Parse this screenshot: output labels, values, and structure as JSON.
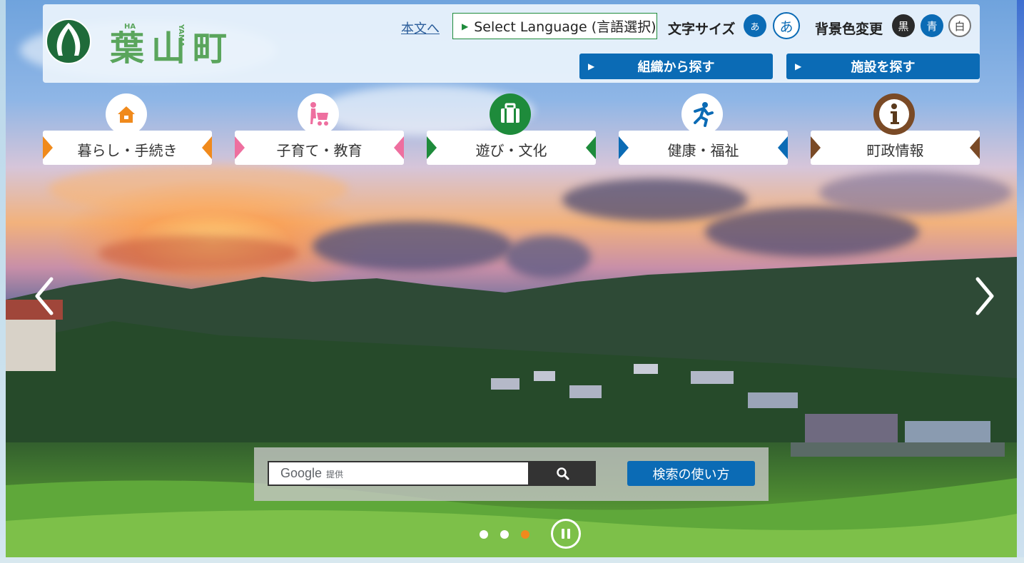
{
  "header": {
    "logo_text": "葉山町",
    "logo_romaji_ha": "HA",
    "logo_romaji_yama": "YAMA",
    "skip_link": "本文へ",
    "language_button": "Select Language (言語選択)",
    "font_size_label": "文字サイズ",
    "font_small": "あ",
    "font_large": "あ",
    "bg_label": "背景色変更",
    "bg_black": "黒",
    "bg_blue": "青",
    "bg_white": "白",
    "search_by_org": "組織から探す",
    "search_by_facility": "施設を探す"
  },
  "categories": [
    {
      "label": "暮らし・手続き",
      "color": "#f08a1c",
      "icon": "house-icon"
    },
    {
      "label": "子育て・教育",
      "color": "#ee6f9f",
      "icon": "stroller-icon"
    },
    {
      "label": "遊び・文化",
      "color": "#1e8b3b",
      "icon": "suitcase-icon"
    },
    {
      "label": "健康・福祉",
      "color": "#0b6bb5",
      "icon": "running-person-icon"
    },
    {
      "label": "町政情報",
      "color": "#7a4a26",
      "icon": "info-icon"
    }
  ],
  "search": {
    "provider": "Google",
    "provider_suffix": "提供",
    "help_button": "検索の使い方"
  },
  "carousel": {
    "slides": 3,
    "active_slide": 3
  }
}
